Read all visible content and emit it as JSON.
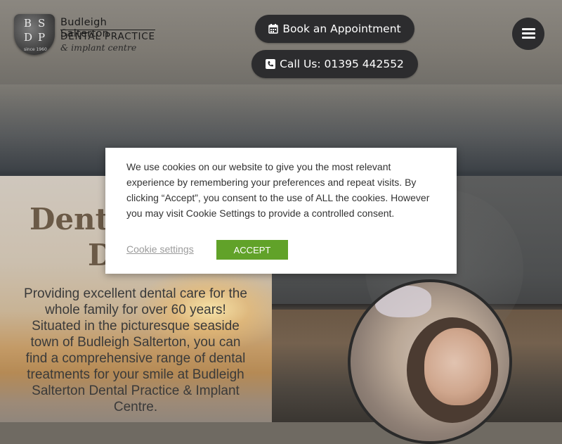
{
  "header": {
    "logo": {
      "letters": [
        "B",
        "S",
        "D",
        "P"
      ],
      "since": "since 1960",
      "line1": "Budleigh Salterton",
      "line2": "DENTAL PRACTICE",
      "line3": "& implant centre"
    },
    "book_button": {
      "label": "Book an Appointment",
      "icon": "calendar-icon"
    },
    "call_button": {
      "label": "Call Us: 01395 442552",
      "icon": "phone-icon"
    },
    "menu_button": {
      "icon": "hamburger-menu-icon"
    }
  },
  "hero": {
    "title_part1": "Denti",
    "title_part2": "D",
    "description": "Providing excellent dental care for the whole family for over 60 years! Situated in the picturesque seaside town of Budleigh Salterton, you can find a comprehensive range of dental treatments for your smile at Budleigh Salterton Dental Practice & Implant Centre."
  },
  "cookie_banner": {
    "message": "We use cookies on our website to give you the most relevant experience by remembering your preferences and repeat visits. By clicking “Accept”, you consent to the use of ALL the cookies. However you may visit Cookie Settings to provide a controlled consent.",
    "settings_link": "Cookie settings",
    "accept_button": "ACCEPT"
  },
  "colors": {
    "button_bg": "#2c2c2e",
    "accept_green": "#61a229",
    "title_brown": "#6b5a47"
  }
}
